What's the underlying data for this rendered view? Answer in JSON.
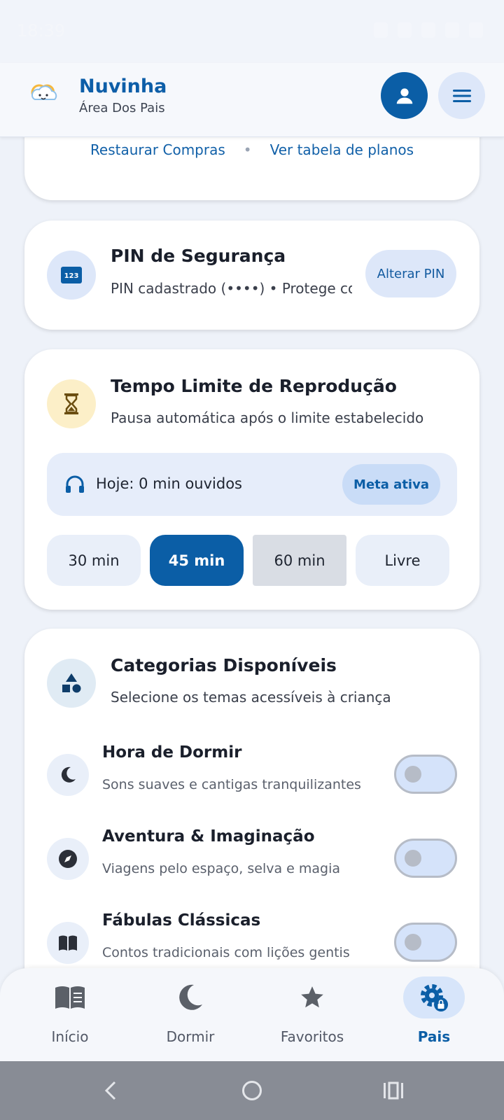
{
  "status_bar": {
    "time": "18:39"
  },
  "header": {
    "title": "Nuvinha",
    "subtitle": "Área Dos Pais",
    "profile_icon": "person-icon",
    "menu_icon": "hamburger-menu-icon"
  },
  "purchases": {
    "restore_label": "Restaurar Compras",
    "separator": "•",
    "plans_label": "Ver tabela de planos"
  },
  "pin": {
    "icon": "numeric-keypad-icon",
    "icon_text": "123",
    "title": "PIN de Segurança",
    "description": "PIN cadastrado (••••) • Protege co…",
    "button_label": "Alterar PIN"
  },
  "time_limit": {
    "icon": "hourglass-icon",
    "title": "Tempo Limite de Reprodução",
    "description": "Pausa automática após o limite estabelecido",
    "today_icon": "headphones-icon",
    "today_text": "Hoje: 0 min ouvidos",
    "badge": "Meta ativa",
    "options": [
      "30 min",
      "45 min",
      "60 min",
      "Livre"
    ],
    "selected": "45 min"
  },
  "categories": {
    "icon": "shapes-icon",
    "title": "Categorias Disponíveis",
    "description": "Selecione os temas acessíveis à criança",
    "items": [
      {
        "name": "Hora de Dormir",
        "description": "Sons suaves e cantigas tranquilizantes",
        "icon": "moon-icon",
        "enabled": false
      },
      {
        "name": "Aventura & Imaginação",
        "description": "Viagens pelo espaço, selva e magia",
        "icon": "compass-icon",
        "enabled": false
      },
      {
        "name": "Fábulas Clássicas",
        "description": "Contos tradicionais com lições gentis",
        "icon": "open-book-icon",
        "enabled": false
      }
    ]
  },
  "bottom_nav": {
    "items": [
      {
        "label": "Início",
        "icon": "book-icon"
      },
      {
        "label": "Dormir",
        "icon": "moon-icon"
      },
      {
        "label": "Favoritos",
        "icon": "star-icon"
      },
      {
        "label": "Pais",
        "icon": "gear-lock-icon"
      }
    ],
    "active": "Pais"
  },
  "colors": {
    "primary": "#0b5ea6",
    "background": "#eef2f9",
    "surface": "#ffffff",
    "accent_light": "#dde7f9"
  }
}
